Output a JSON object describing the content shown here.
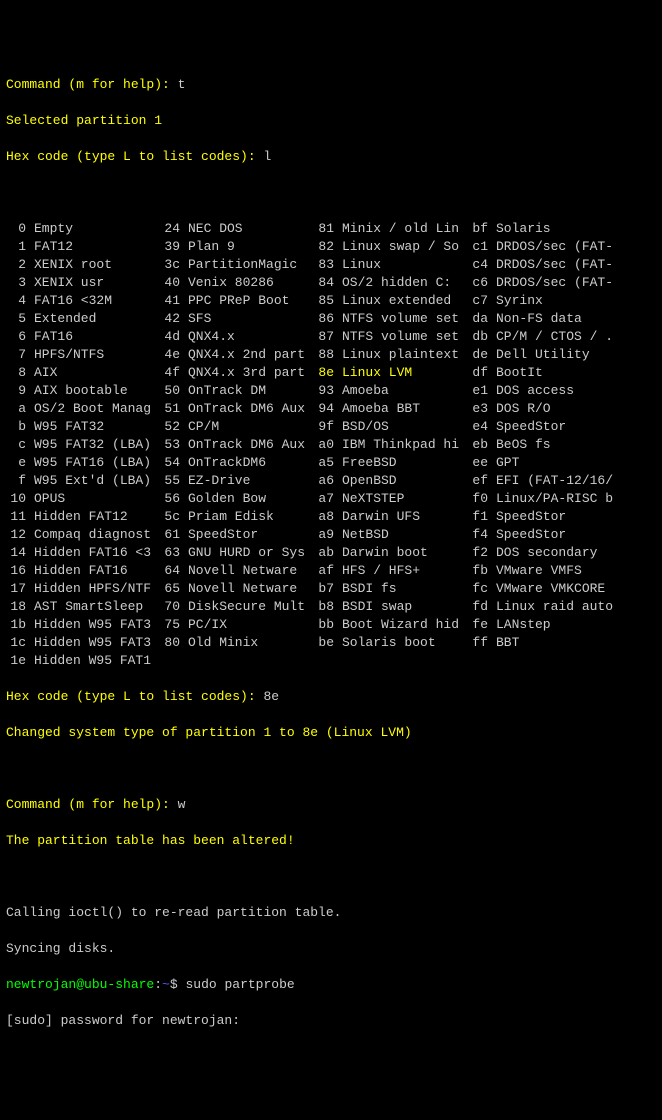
{
  "prompts": {
    "cmd_help": "Command (m for help): ",
    "cmd_t": "t",
    "selected": "Selected partition 1",
    "hex_prompt": "Hex code (type L to list codes): ",
    "hex_l": "l",
    "hex_8e": "8e",
    "changed": "Changed system type of partition 1 to 8e (Linux LVM)",
    "cmd_w": "w",
    "altered": "The partition table has been altered!",
    "ioctl": "Calling ioctl() to re-read partition table.",
    "syncing": "Syncing disks.",
    "shell_user": "newtrojan@ubu-share",
    "shell_sep": ":",
    "shell_path": "~",
    "shell_dollar": "$ ",
    "shell_cmd": "sudo partprobe",
    "sudo_pw": "[sudo] password for newtrojan:"
  },
  "highlight": {
    "code": "8e",
    "name": "Linux LVM"
  },
  "table": [
    [
      [
        "0",
        "Empty"
      ],
      [
        "24",
        "NEC DOS"
      ],
      [
        "81",
        "Minix / old Lin"
      ],
      [
        "bf",
        "Solaris"
      ]
    ],
    [
      [
        "1",
        "FAT12"
      ],
      [
        "39",
        "Plan 9"
      ],
      [
        "82",
        "Linux swap / So"
      ],
      [
        "c1",
        "DRDOS/sec (FAT-"
      ]
    ],
    [
      [
        "2",
        "XENIX root"
      ],
      [
        "3c",
        "PartitionMagic"
      ],
      [
        "83",
        "Linux"
      ],
      [
        "c4",
        "DRDOS/sec (FAT-"
      ]
    ],
    [
      [
        "3",
        "XENIX usr"
      ],
      [
        "40",
        "Venix 80286"
      ],
      [
        "84",
        "OS/2 hidden C:"
      ],
      [
        "c6",
        "DRDOS/sec (FAT-"
      ]
    ],
    [
      [
        "4",
        "FAT16 <32M"
      ],
      [
        "41",
        "PPC PReP Boot"
      ],
      [
        "85",
        "Linux extended"
      ],
      [
        "c7",
        "Syrinx"
      ]
    ],
    [
      [
        "5",
        "Extended"
      ],
      [
        "42",
        "SFS"
      ],
      [
        "86",
        "NTFS volume set"
      ],
      [
        "da",
        "Non-FS data"
      ]
    ],
    [
      [
        "6",
        "FAT16"
      ],
      [
        "4d",
        "QNX4.x"
      ],
      [
        "87",
        "NTFS volume set"
      ],
      [
        "db",
        "CP/M / CTOS / ."
      ]
    ],
    [
      [
        "7",
        "HPFS/NTFS"
      ],
      [
        "4e",
        "QNX4.x 2nd part"
      ],
      [
        "88",
        "Linux plaintext"
      ],
      [
        "de",
        "Dell Utility"
      ]
    ],
    [
      [
        "8",
        "AIX"
      ],
      [
        "4f",
        "QNX4.x 3rd part"
      ],
      [
        "8e",
        "Linux LVM"
      ],
      [
        "df",
        "BootIt"
      ]
    ],
    [
      [
        "9",
        "AIX bootable"
      ],
      [
        "50",
        "OnTrack DM"
      ],
      [
        "93",
        "Amoeba"
      ],
      [
        "e1",
        "DOS access"
      ]
    ],
    [
      [
        "a",
        "OS/2 Boot Manag"
      ],
      [
        "51",
        "OnTrack DM6 Aux"
      ],
      [
        "94",
        "Amoeba BBT"
      ],
      [
        "e3",
        "DOS R/O"
      ]
    ],
    [
      [
        "b",
        "W95 FAT32"
      ],
      [
        "52",
        "CP/M"
      ],
      [
        "9f",
        "BSD/OS"
      ],
      [
        "e4",
        "SpeedStor"
      ]
    ],
    [
      [
        "c",
        "W95 FAT32 (LBA)"
      ],
      [
        "53",
        "OnTrack DM6 Aux"
      ],
      [
        "a0",
        "IBM Thinkpad hi"
      ],
      [
        "eb",
        "BeOS fs"
      ]
    ],
    [
      [
        "e",
        "W95 FAT16 (LBA)"
      ],
      [
        "54",
        "OnTrackDM6"
      ],
      [
        "a5",
        "FreeBSD"
      ],
      [
        "ee",
        "GPT"
      ]
    ],
    [
      [
        "f",
        "W95 Ext'd (LBA)"
      ],
      [
        "55",
        "EZ-Drive"
      ],
      [
        "a6",
        "OpenBSD"
      ],
      [
        "ef",
        "EFI (FAT-12/16/"
      ]
    ],
    [
      [
        "10",
        "OPUS"
      ],
      [
        "56",
        "Golden Bow"
      ],
      [
        "a7",
        "NeXTSTEP"
      ],
      [
        "f0",
        "Linux/PA-RISC b"
      ]
    ],
    [
      [
        "11",
        "Hidden FAT12"
      ],
      [
        "5c",
        "Priam Edisk"
      ],
      [
        "a8",
        "Darwin UFS"
      ],
      [
        "f1",
        "SpeedStor"
      ]
    ],
    [
      [
        "12",
        "Compaq diagnost"
      ],
      [
        "61",
        "SpeedStor"
      ],
      [
        "a9",
        "NetBSD"
      ],
      [
        "f4",
        "SpeedStor"
      ]
    ],
    [
      [
        "14",
        "Hidden FAT16 <3"
      ],
      [
        "63",
        "GNU HURD or Sys"
      ],
      [
        "ab",
        "Darwin boot"
      ],
      [
        "f2",
        "DOS secondary"
      ]
    ],
    [
      [
        "16",
        "Hidden FAT16"
      ],
      [
        "64",
        "Novell Netware"
      ],
      [
        "af",
        "HFS / HFS+"
      ],
      [
        "fb",
        "VMware VMFS"
      ]
    ],
    [
      [
        "17",
        "Hidden HPFS/NTF"
      ],
      [
        "65",
        "Novell Netware"
      ],
      [
        "b7",
        "BSDI fs"
      ],
      [
        "fc",
        "VMware VMKCORE"
      ]
    ],
    [
      [
        "18",
        "AST SmartSleep"
      ],
      [
        "70",
        "DiskSecure Mult"
      ],
      [
        "b8",
        "BSDI swap"
      ],
      [
        "fd",
        "Linux raid auto"
      ]
    ],
    [
      [
        "1b",
        "Hidden W95 FAT3"
      ],
      [
        "75",
        "PC/IX"
      ],
      [
        "bb",
        "Boot Wizard hid"
      ],
      [
        "fe",
        "LANstep"
      ]
    ],
    [
      [
        "1c",
        "Hidden W95 FAT3"
      ],
      [
        "80",
        "Old Minix"
      ],
      [
        "be",
        "Solaris boot"
      ],
      [
        "ff",
        "BBT"
      ]
    ],
    [
      [
        "1e",
        "Hidden W95 FAT1"
      ],
      [
        "",
        ""
      ],
      [
        "",
        ""
      ],
      [
        "",
        ""
      ]
    ]
  ]
}
